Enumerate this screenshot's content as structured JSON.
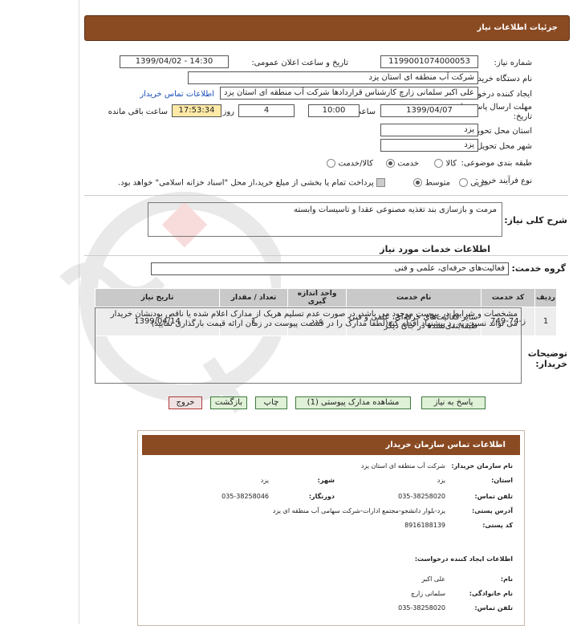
{
  "page": {
    "header_title": "جزئیات اطلاعات نیاز"
  },
  "fields": {
    "need_number_label": "شماره نیاز:",
    "need_number": "1199001074000053",
    "announce_label": "تاریخ و ساعت اعلان عمومی:",
    "announce_value": "1399/04/02 - 14:30",
    "buyer_label": "نام دستگاه خریدار:",
    "buyer_value": "شرکت آب منطقه ای استان یزد",
    "creator_label": "ایجاد کننده درخواست:",
    "creator_value": "علی اکبر سلمانی زارچ کارشناس قراردادها شرکت آب منطقه ای استان یزد",
    "contact_link": "اطلاعات تماس خریدار",
    "deadline_label_1": "مهلت ارسال پاسخ: تا",
    "deadline_label_2": "تاریخ:",
    "deadline_date": "1399/04/07",
    "time_label": "ساعت",
    "deadline_time": "10:00",
    "days_value": "4",
    "days_label": "روز و",
    "remaining_time": "17:53:34",
    "remaining_label": "ساعت باقی مانده",
    "province_label": "استان محل تحویل:",
    "province_value": "یزد",
    "city_label": "شهر محل تحویل:",
    "city_value": "یزد",
    "category_label": "طبقه بندی موضوعی:",
    "category_options": [
      "کالا",
      "خدمت",
      "کالا/خدمت"
    ],
    "process_label": "نوع فرآیند خرید :",
    "process_options": [
      "جزیی",
      "متوسط"
    ],
    "payment_note": "پرداخت تمام یا بخشی از مبلغ خرید،از محل \"اسناد خزانه اسلامی\" خواهد بود.",
    "description_label": "شرح کلی نیاز:",
    "description_value": "مرمت و بازسازی بند تغذیه مصنوعی عقدا و تاسیسات وابسته",
    "services_title": "اطلاعات خدمات مورد نیاز",
    "service_group_label": "گروه خدمت:",
    "service_group_value": "فعالیت‌های حرفه‌ای، علمی و فنی"
  },
  "table": {
    "headers": [
      "ردیف",
      "کد خدمت",
      "نام خدمت",
      "واحد اندازه گیری",
      "تعداد / مقدار",
      "تاریخ نیاز"
    ],
    "rows": [
      {
        "index": "1",
        "code": "ز-74-749",
        "name": "سایر فعالیت‌های حرفه‌ای، علمی و فنی طبقه‌بندی‌نشده در جای دیگر",
        "unit": "عدد",
        "qty": "1",
        "date": "1399/04/14"
      }
    ]
  },
  "notes": {
    "label": "توضیحات خریدار:",
    "text": "مشخصات و شرایط در پیوست موجود می باشد، در صورت عدم تسلیم هریک از مدارک اعلام شده یا ناقص بودنشان خریدار می تواند نسبت به رد پیشنهاد اقدام کند(لطفا مدارک را در قسمت پیوست در زمان ارائه قیمت بارگذاری نمایید)"
  },
  "buttons": {
    "reply": "پاسخ به نیاز",
    "attachments": "مشاهده مدارک پیوستی (1)",
    "print": "چاپ",
    "back": "بازگشت",
    "exit": "خروج"
  },
  "popup": {
    "title": "اطلاعات تماس سازمان خریدار",
    "org_label": "نام سازمان خریدار:",
    "org_value": "شرکت آب منطقه ای استان یزد",
    "province_label": "استان:",
    "province_value": "یزد",
    "city_label": "شهر:",
    "city_value": "یزد",
    "phone_label": "تلفن تماس:",
    "phone_value": "035-38258020",
    "fax_label": "دورنگار:",
    "fax_value": "035-38258046",
    "address_label": "آدرس پستی:",
    "address_value": "یزد-بلوار دانشجو-مجتمع ادارات-شرکت سهامی آب منطقه ای یزد",
    "postal_label": "کد پستی:",
    "postal_value": "8916188139",
    "creator_title": "اطلاعات ایجاد کننده درخواست:",
    "name_label": "نام:",
    "name_value": "علی اکبر",
    "family_label": "نام خانوادگی:",
    "family_value": "سلمانی زارچ",
    "cphone_label": "تلفن تماس:",
    "cphone_value": "035-38258020"
  },
  "colors": {
    "header": "#8a4a22",
    "highlight": "#ffe9a6",
    "button_green": "#dff1d6",
    "link": "#1a4fb8"
  }
}
